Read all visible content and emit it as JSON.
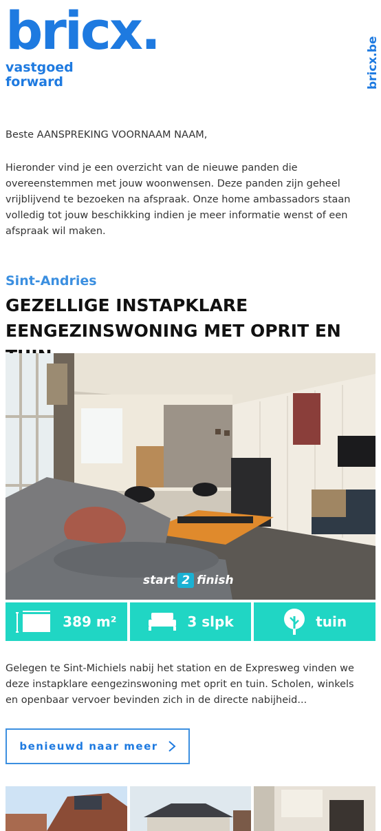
{
  "brand": {
    "logo": "bricx.",
    "tagline_line1": "vastgoed",
    "tagline_line2": "forward",
    "domain": "bricx.be",
    "color": "#1e7ae0"
  },
  "email": {
    "greeting": "Beste AANSPREKING VOORNAAM NAAM,",
    "intro": "Hieronder vind je een overzicht van de nieuwe panden die overeenstemmen met jouw woonwensen. Deze panden zijn geheel vrijblijvend te bezoeken na afspraak. Onze home ambassadors staan volledig tot jouw beschikking indien je meer informatie wenst of een afspraak wil maken."
  },
  "listing": {
    "location": "Sint-Andries",
    "title": "GEZELLIGE INSTAPKLARE EENGEZINSWONING MET OPRIT EN TUIN",
    "photo_badge": {
      "prefix": "start",
      "number": "2",
      "suffix": "finish"
    },
    "features": [
      {
        "icon": "area-icon",
        "label": "389 m²"
      },
      {
        "icon": "bed-icon",
        "label": "3 slpk"
      },
      {
        "icon": "tree-icon",
        "label": "tuin"
      }
    ],
    "description": "Gelegen te Sint-Michiels nabij het station en de Expresweg vinden we deze instapklare eengezinswoning met oprit en tuin. Scholen, winkels en openbaar vervoer bevinden zich in de directe nabijheid...",
    "cta_label": "benieuwd naar meer",
    "accent": "#20d6c4"
  }
}
